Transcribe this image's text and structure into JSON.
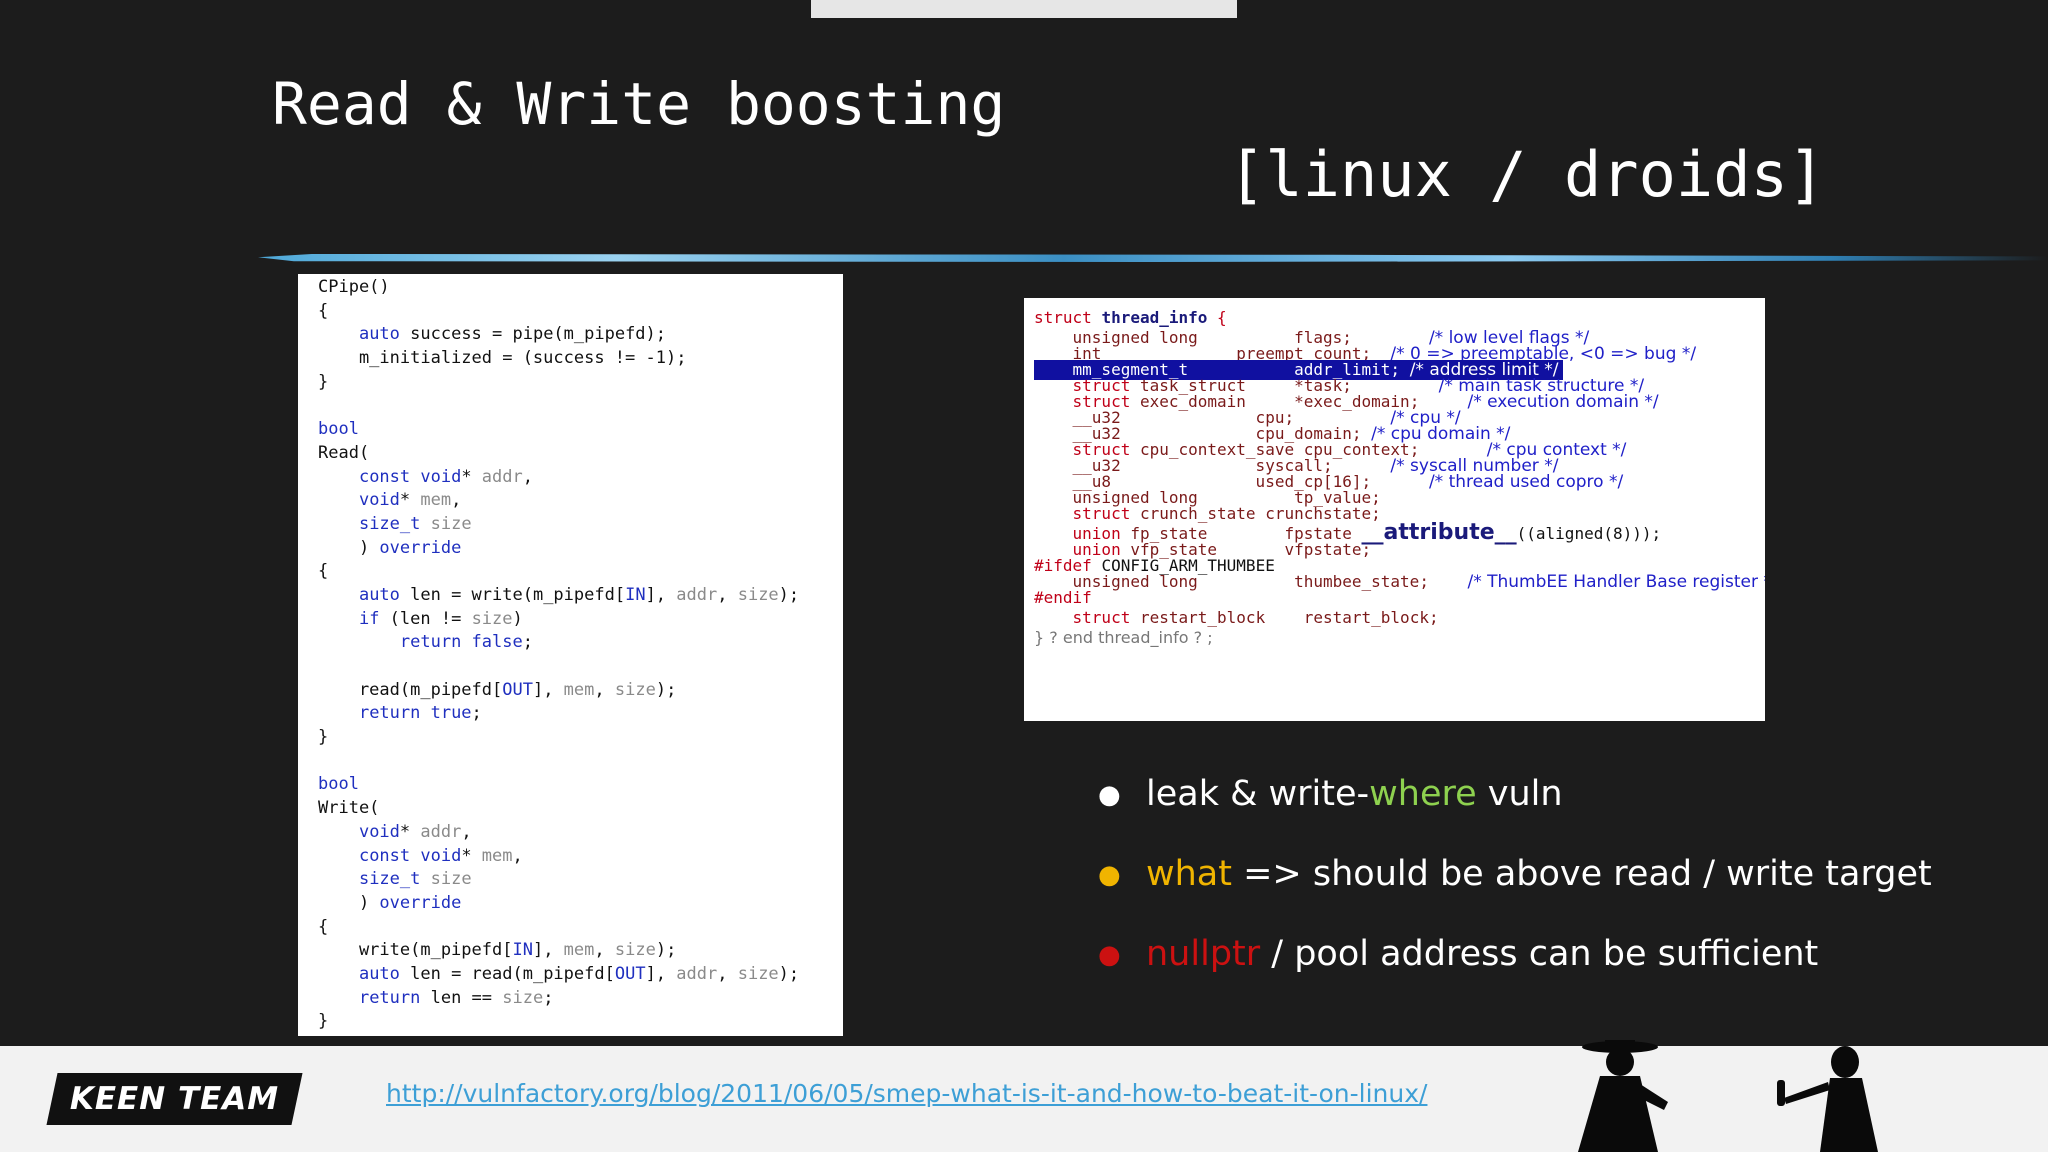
{
  "slide": {
    "title": "Read & Write boosting",
    "subtitle": "[linux / droids]"
  },
  "code_left": {
    "lines": [
      {
        "segs": [
          {
            "t": "CPipe()",
            "c": ""
          }
        ]
      },
      {
        "segs": [
          {
            "t": "{",
            "c": ""
          }
        ]
      },
      {
        "segs": [
          {
            "t": "    ",
            "c": ""
          },
          {
            "t": "auto",
            "c": "k"
          },
          {
            "t": " success = pipe(m_pipefd);",
            "c": ""
          }
        ]
      },
      {
        "segs": [
          {
            "t": "    m_initialized = (success != -1);",
            "c": ""
          }
        ]
      },
      {
        "segs": [
          {
            "t": "}",
            "c": ""
          }
        ]
      },
      {
        "segs": [
          {
            "t": "",
            "c": ""
          }
        ]
      },
      {
        "segs": [
          {
            "t": "bool",
            "c": "k"
          }
        ]
      },
      {
        "segs": [
          {
            "t": "Read(",
            "c": ""
          }
        ]
      },
      {
        "segs": [
          {
            "t": "    ",
            "c": ""
          },
          {
            "t": "const void",
            "c": "k"
          },
          {
            "t": "* ",
            "c": ""
          },
          {
            "t": "addr",
            "c": "g"
          },
          {
            "t": ",",
            "c": ""
          }
        ]
      },
      {
        "segs": [
          {
            "t": "    ",
            "c": ""
          },
          {
            "t": "void",
            "c": "k"
          },
          {
            "t": "* ",
            "c": ""
          },
          {
            "t": "mem",
            "c": "g"
          },
          {
            "t": ",",
            "c": ""
          }
        ]
      },
      {
        "segs": [
          {
            "t": "    ",
            "c": ""
          },
          {
            "t": "size_t",
            "c": "k"
          },
          {
            "t": " size",
            "c": "g"
          }
        ]
      },
      {
        "segs": [
          {
            "t": "    ) ",
            "c": ""
          },
          {
            "t": "override",
            "c": "k"
          }
        ]
      },
      {
        "segs": [
          {
            "t": "{",
            "c": ""
          }
        ]
      },
      {
        "segs": [
          {
            "t": "    ",
            "c": ""
          },
          {
            "t": "auto",
            "c": "k"
          },
          {
            "t": " len = write(m_pipefd[",
            "c": ""
          },
          {
            "t": "IN",
            "c": "k"
          },
          {
            "t": "], ",
            "c": ""
          },
          {
            "t": "addr",
            "c": "g"
          },
          {
            "t": ", ",
            "c": ""
          },
          {
            "t": "size",
            "c": "g"
          },
          {
            "t": ");",
            "c": ""
          }
        ]
      },
      {
        "segs": [
          {
            "t": "    ",
            "c": ""
          },
          {
            "t": "if",
            "c": "k"
          },
          {
            "t": " (len != ",
            "c": ""
          },
          {
            "t": "size",
            "c": "g"
          },
          {
            "t": ")",
            "c": ""
          }
        ]
      },
      {
        "segs": [
          {
            "t": "        ",
            "c": ""
          },
          {
            "t": "return false",
            "c": "k"
          },
          {
            "t": ";",
            "c": ""
          }
        ]
      },
      {
        "segs": [
          {
            "t": "",
            "c": ""
          }
        ]
      },
      {
        "segs": [
          {
            "t": "    read(m_pipefd[",
            "c": ""
          },
          {
            "t": "OUT",
            "c": "k"
          },
          {
            "t": "], ",
            "c": ""
          },
          {
            "t": "mem",
            "c": "g"
          },
          {
            "t": ", ",
            "c": ""
          },
          {
            "t": "size",
            "c": "g"
          },
          {
            "t": ");",
            "c": ""
          }
        ]
      },
      {
        "segs": [
          {
            "t": "    ",
            "c": ""
          },
          {
            "t": "return true",
            "c": "k"
          },
          {
            "t": ";",
            "c": ""
          }
        ]
      },
      {
        "segs": [
          {
            "t": "}",
            "c": ""
          }
        ]
      },
      {
        "segs": [
          {
            "t": "",
            "c": ""
          }
        ]
      },
      {
        "segs": [
          {
            "t": "bool",
            "c": "k"
          }
        ]
      },
      {
        "segs": [
          {
            "t": "Write(",
            "c": ""
          }
        ]
      },
      {
        "segs": [
          {
            "t": "    ",
            "c": ""
          },
          {
            "t": "void",
            "c": "k"
          },
          {
            "t": "* ",
            "c": ""
          },
          {
            "t": "addr",
            "c": "g"
          },
          {
            "t": ",",
            "c": ""
          }
        ]
      },
      {
        "segs": [
          {
            "t": "    ",
            "c": ""
          },
          {
            "t": "const void",
            "c": "k"
          },
          {
            "t": "* ",
            "c": ""
          },
          {
            "t": "mem",
            "c": "g"
          },
          {
            "t": ",",
            "c": ""
          }
        ]
      },
      {
        "segs": [
          {
            "t": "    ",
            "c": ""
          },
          {
            "t": "size_t",
            "c": "k"
          },
          {
            "t": " size",
            "c": "g"
          }
        ]
      },
      {
        "segs": [
          {
            "t": "    ) ",
            "c": ""
          },
          {
            "t": "override",
            "c": "k"
          }
        ]
      },
      {
        "segs": [
          {
            "t": "{",
            "c": ""
          }
        ]
      },
      {
        "segs": [
          {
            "t": "    write(m_pipefd[",
            "c": ""
          },
          {
            "t": "IN",
            "c": "k"
          },
          {
            "t": "], ",
            "c": ""
          },
          {
            "t": "mem",
            "c": "g"
          },
          {
            "t": ", ",
            "c": ""
          },
          {
            "t": "size",
            "c": "g"
          },
          {
            "t": ");",
            "c": ""
          }
        ]
      },
      {
        "segs": [
          {
            "t": "    ",
            "c": ""
          },
          {
            "t": "auto",
            "c": "k"
          },
          {
            "t": " len = read(m_pipefd[",
            "c": ""
          },
          {
            "t": "OUT",
            "c": "k"
          },
          {
            "t": "], ",
            "c": ""
          },
          {
            "t": "addr",
            "c": "g"
          },
          {
            "t": ", ",
            "c": ""
          },
          {
            "t": "size",
            "c": "g"
          },
          {
            "t": ");",
            "c": ""
          }
        ]
      },
      {
        "segs": [
          {
            "t": "    ",
            "c": ""
          },
          {
            "t": "return",
            "c": "k"
          },
          {
            "t": " len == ",
            "c": ""
          },
          {
            "t": "size",
            "c": "g"
          },
          {
            "t": ";",
            "c": ""
          }
        ]
      },
      {
        "segs": [
          {
            "t": "}",
            "c": ""
          }
        ]
      }
    ]
  },
  "code_right": {
    "lines": [
      {
        "segs": [
          {
            "t": "struct ",
            "c": "kw"
          },
          {
            "t": "thread_info",
            "c": "bold2"
          },
          {
            "t": " {",
            "c": "kw"
          }
        ]
      },
      {
        "segs": [
          {
            "t": "    unsigned long          flags;        ",
            "c": "ty"
          },
          {
            "t": "/* low level flags */",
            "c": "cm"
          }
        ]
      },
      {
        "segs": [
          {
            "t": "    int              preempt_count;  ",
            "c": "ty"
          },
          {
            "t": "/* 0 => preemptable, <0 => bug */",
            "c": "cm"
          }
        ]
      },
      {
        "segs": [
          {
            "t": "    mm_segment_t           addr_limit; ",
            "c": "hl"
          },
          {
            "t": "/* address limit */",
            "c": "hlc"
          }
        ]
      },
      {
        "segs": [
          {
            "t": "    struct ",
            "c": "kw"
          },
          {
            "t": "task_struct     *task;         ",
            "c": "ty"
          },
          {
            "t": "/* main task structure */",
            "c": "cm"
          }
        ]
      },
      {
        "segs": [
          {
            "t": "    struct ",
            "c": "kw"
          },
          {
            "t": "exec_domain     *exec_domain;     ",
            "c": "ty"
          },
          {
            "t": "/* execution domain */",
            "c": "cm"
          }
        ]
      },
      {
        "segs": [
          {
            "t": "    __u32              cpu;          ",
            "c": "ty"
          },
          {
            "t": "/* cpu */",
            "c": "cm"
          }
        ]
      },
      {
        "segs": [
          {
            "t": "    __u32              cpu_domain; ",
            "c": "ty"
          },
          {
            "t": "/* cpu domain */",
            "c": "cm"
          }
        ]
      },
      {
        "segs": [
          {
            "t": "    struct ",
            "c": "kw"
          },
          {
            "t": "cpu_context_save cpu_context;       ",
            "c": "ty"
          },
          {
            "t": "/* cpu context */",
            "c": "cm"
          }
        ]
      },
      {
        "segs": [
          {
            "t": "    __u32              syscall;      ",
            "c": "ty"
          },
          {
            "t": "/* syscall number */",
            "c": "cm"
          }
        ]
      },
      {
        "segs": [
          {
            "t": "    __u8               used_cp[16];      ",
            "c": "ty"
          },
          {
            "t": "/* thread used copro */",
            "c": "cm"
          }
        ]
      },
      {
        "segs": [
          {
            "t": "    unsigned long          tp_value;",
            "c": "ty"
          }
        ]
      },
      {
        "segs": [
          {
            "t": "    struct ",
            "c": "kw"
          },
          {
            "t": "crunch_state crunchstate;",
            "c": "ty"
          }
        ]
      },
      {
        "segs": [
          {
            "t": "    union ",
            "c": "kw"
          },
          {
            "t": "fp_state        fpstate ",
            "c": "ty"
          },
          {
            "t": "__attribute__",
            "c": "bold"
          },
          {
            "t": "((aligned(8)));",
            "c": "dark"
          }
        ]
      },
      {
        "segs": [
          {
            "t": "    union ",
            "c": "kw"
          },
          {
            "t": "vfp_state       vfpstate;",
            "c": "ty"
          }
        ]
      },
      {
        "segs": [
          {
            "t": "#ifdef ",
            "c": "pp"
          },
          {
            "t": "CONFIG_ARM_THUMBEE",
            "c": "dark"
          }
        ]
      },
      {
        "segs": [
          {
            "t": "    unsigned long          thumbee_state;    ",
            "c": "ty"
          },
          {
            "t": "/* ThumbEE Handler Base register */",
            "c": "cm"
          }
        ]
      },
      {
        "segs": [
          {
            "t": "#endif",
            "c": "pp"
          }
        ]
      },
      {
        "segs": [
          {
            "t": "    struct ",
            "c": "kw"
          },
          {
            "t": "restart_block    restart_block;",
            "c": "ty"
          }
        ]
      },
      {
        "segs": [
          {
            "t": "} ? end thread_info ? ;",
            "c": "gr"
          }
        ]
      }
    ]
  },
  "bullets": [
    {
      "color": "#ffffff",
      "segs": [
        {
          "t": "leak & write-",
          "color": "#ffffff"
        },
        {
          "t": "where",
          "color": "#8ed14f"
        },
        {
          "t": " vuln",
          "color": "#ffffff"
        }
      ]
    },
    {
      "color": "#f0b400",
      "segs": [
        {
          "t": "what",
          "color": "#f0b400"
        },
        {
          "t": " => should be above read / write target",
          "color": "#ffffff"
        }
      ]
    },
    {
      "color": "#cc1111",
      "segs": [
        {
          "t": "nullptr",
          "color": "#cc1111"
        },
        {
          "t": " / pool address can be sufficient",
          "color": "#ffffff"
        }
      ]
    }
  ],
  "footer": {
    "logo": "KEEN TEAM",
    "link": "http://vulnfactory.org/blog/2011/06/05/smep-what-is-it-and-how-to-beat-it-on-linux/"
  }
}
